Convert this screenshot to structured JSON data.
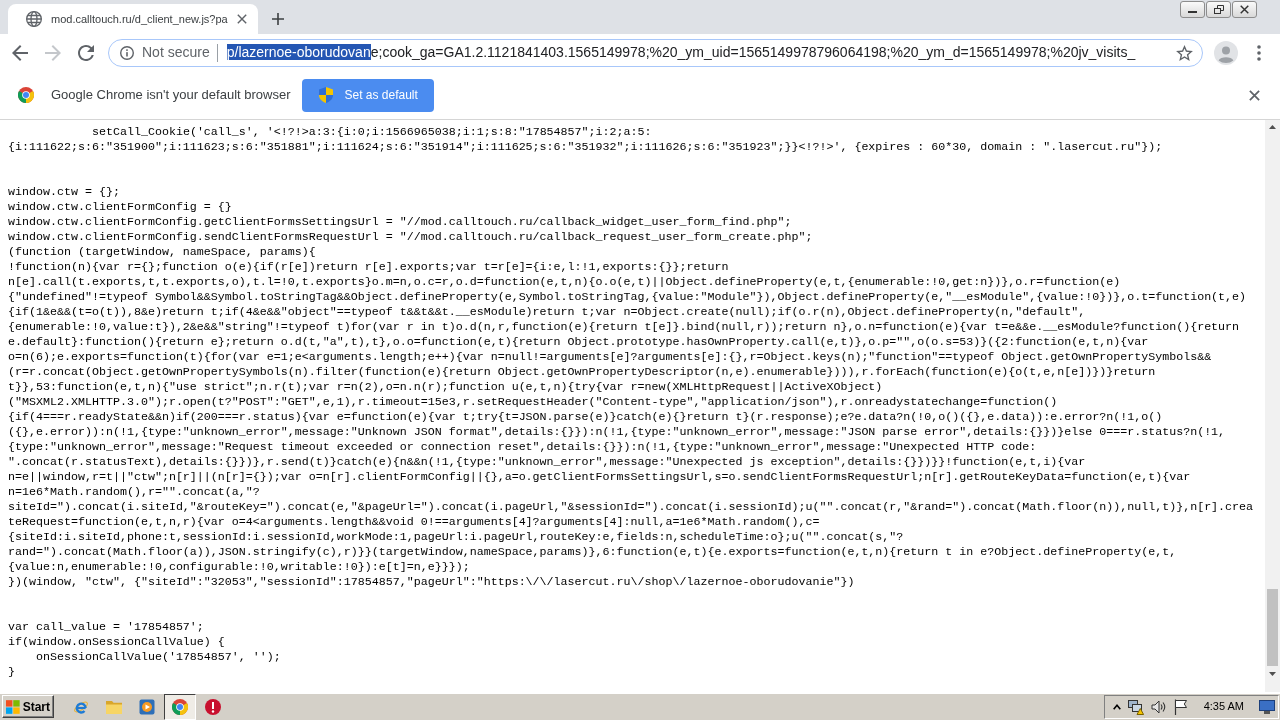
{
  "window": {
    "tabs": [
      {
        "title": "mod.calltouch.ru/d_client_new.js?pa",
        "selected": true
      }
    ]
  },
  "toolbar": {
    "nav": [
      {
        "kind": "back",
        "disabled": false
      },
      {
        "kind": "forward",
        "disabled": true
      },
      {
        "kind": "reload",
        "disabled": false
      }
    ],
    "omnibox": {
      "security_label": "Not secure",
      "url_selected": "p/lazernoe-oborudovan",
      "url_rest": "e;cook_ga=GA1.2.1121841403.1565149978;%20_ym_uid=1565149978796064198;%20_ym_d=1565149978;%20jv_visits_"
    }
  },
  "infobar": {
    "message": "Google Chrome isn't your default browser",
    "button": "Set as default"
  },
  "document": {
    "blocks": [
      [
        "            setCall_Cookie('call_s', '<!?!>a:3:{i:0;i:1566965038;i:1;s:8:\"17854857\";i:2;a:5:",
        "{i:111622;s:6:\"351900\";i:111623;s:6:\"351881\";i:111624;s:6:\"351914\";i:111625;s:6:\"351932\";i:111626;s:6:\"351923\";}}<!?!>', {expires : 60*30, domain : \".lasercut.ru\"});"
      ],
      [
        "window.ctw = {};",
        "window.ctw.clientFormConfig = {}",
        "window.ctw.clientFormConfig.getClientFormsSettingsUrl = \"//mod.calltouch.ru/callback_widget_user_form_find.php\";",
        "window.ctw.clientFormConfig.sendClientFormsRequestUrl = \"//mod.calltouch.ru/callback_request_user_form_create.php\";",
        "(function (targetWindow, nameSpace, params){",
        "!function(n){var r={};function o(e){if(r[e])return r[e].exports;var t=r[e]={i:e,l:!1,exports:{}};return",
        "n[e].call(t.exports,t,t.exports,o),t.l=!0,t.exports}o.m=n,o.c=r,o.d=function(e,t,n){o.o(e,t)||Object.defineProperty(e,t,{enumerable:!0,get:n})},o.r=function(e)",
        "{\"undefined\"!=typeof Symbol&&Symbol.toStringTag&&Object.defineProperty(e,Symbol.toStringTag,{value:\"Module\"}),Object.defineProperty(e,\"__esModule\",{value:!0})},o.t=function(t,e)",
        "{if(1&e&&(t=o(t)),8&e)return t;if(4&e&&\"object\"==typeof t&&t&&t.__esModule)return t;var n=Object.create(null);if(o.r(n),Object.defineProperty(n,\"default\",",
        "{enumerable:!0,value:t}),2&e&&\"string\"!=typeof t)for(var r in t)o.d(n,r,function(e){return t[e]}.bind(null,r));return n},o.n=function(e){var t=e&&e.__esModule?function(){return",
        "e.default}:function(){return e};return o.d(t,\"a\",t),t},o.o=function(e,t){return Object.prototype.hasOwnProperty.call(e,t)},o.p=\"\",o(o.s=53)}({2:function(e,t,n){var",
        "o=n(6);e.exports=function(t){for(var e=1;e<arguments.length;e++){var n=null!=arguments[e]?arguments[e]:{},r=Object.keys(n);\"function\"==typeof Object.getOwnPropertySymbols&&",
        "(r=r.concat(Object.getOwnPropertySymbols(n).filter(function(e){return Object.getOwnPropertyDescriptor(n,e).enumerable}))),r.forEach(function(e){o(t,e,n[e])})}return",
        "t}},53:function(e,t,n){\"use strict\";n.r(t);var r=n(2),o=n.n(r);function u(e,t,n){try{var r=new(XMLHttpRequest||ActiveXObject)",
        "(\"MSXML2.XMLHTTP.3.0\");r.open(t?\"POST\":\"GET\",e,1),r.timeout=15e3,r.setRequestHeader(\"Content-type\",\"application/json\"),r.onreadystatechange=function()",
        "{if(4===r.readyState&&n)if(200===r.status){var e=function(e){var t;try{t=JSON.parse(e)}catch(e){}return t}(r.response);e?e.data?n(!0,o()({},e.data)):e.error?n(!1,o()",
        "({},e.error)):n(!1,{type:\"unknown_error\",message:\"Unknown JSON format\",details:{}}):n(!1,{type:\"unknown_error\",message:\"JSON parse error\",details:{}})}else 0===r.status?n(!1,",
        "{type:\"unknown_error\",message:\"Request timeout exceeded or connection reset\",details:{}}):n(!1,{type:\"unknown_error\",message:\"Unexpected HTTP code:",
        "\".concat(r.statusText),details:{}})},r.send(t)}catch(e){n&&n(!1,{type:\"unknown_error\",message:\"Unexpected js exception\",details:{}})}}!function(e,t,i){var",
        "n=e||window,r=t||\"ctw\";n[r]||(n[r]={});var o=n[r].clientFormConfig||{},a=o.getClientFormsSettingsUrl,s=o.sendClientFormsRequestUrl;n[r].getRouteKeyData=function(e,t){var",
        "n=1e6*Math.random(),r=\"\".concat(a,\"?",
        "siteId=\").concat(i.siteId,\"&routeKey=\").concat(e,\"&pageUrl=\").concat(i.pageUrl,\"&sessionId=\").concat(i.sessionId);u(\"\".concat(r,\"&rand=\").concat(Math.floor(n)),null,t)},n[r].crea",
        "teRequest=function(e,t,n,r){var o=4<arguments.length&&void 0!==arguments[4]?arguments[4]:null,a=1e6*Math.random(),c=",
        "{siteId:i.siteId,phone:t,sessionId:i.sessionId,workMode:1,pageUrl:i.pageUrl,routeKey:e,fields:n,scheduleTime:o};u(\"\".concat(s,\"?",
        "rand=\").concat(Math.floor(a)),JSON.stringify(c),r)}}(targetWindow,nameSpace,params)},6:function(e,t){e.exports=function(e,t,n){return t in e?Object.defineProperty(e,t,",
        "{value:n,enumerable:!0,configurable:!0,writable:!0}):e[t]=n,e}}});",
        "})(window, \"ctw\", {\"siteId\":\"32053\",\"sessionId\":17854857,\"pageUrl\":\"https:\\/\\/lasercut.ru\\/shop\\/lazernoe-oborudovanie\"})"
      ],
      [
        "var call_value = '17854857';",
        "if(window.onSessionCallValue) {",
        "    onSessionCallValue('17854857', '');",
        "}"
      ]
    ]
  },
  "taskbar": {
    "start": "Start",
    "apps": [
      {
        "kind": "ie",
        "selected": false
      },
      {
        "kind": "folder",
        "selected": false
      },
      {
        "kind": "player",
        "selected": false
      },
      {
        "kind": "chrome",
        "selected": true
      },
      {
        "kind": "alert",
        "selected": false
      }
    ],
    "clock": "4:35 AM"
  }
}
